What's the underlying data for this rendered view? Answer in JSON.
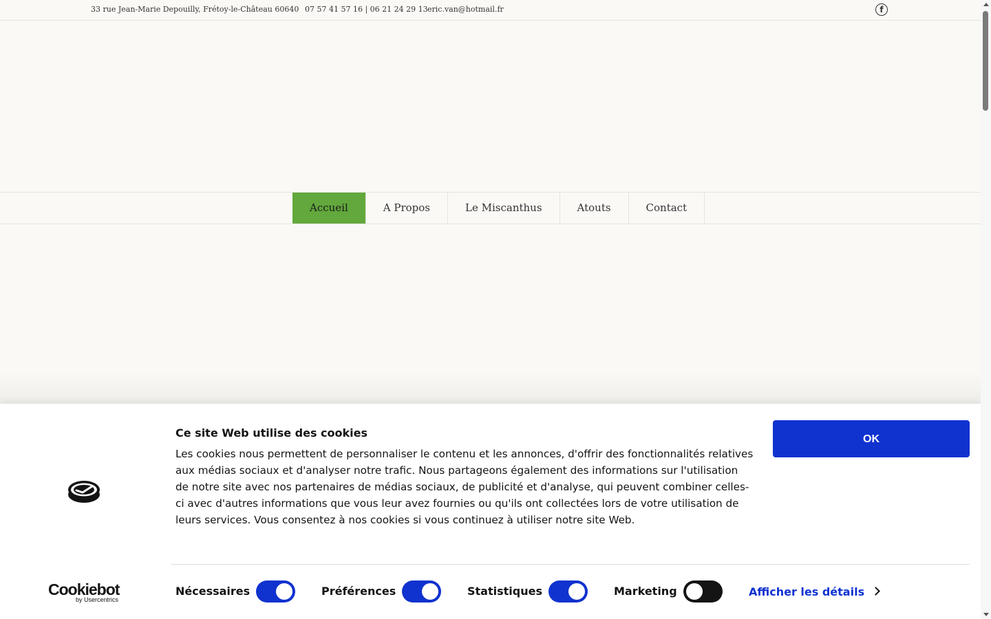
{
  "topbar": {
    "address": "33 rue Jean-Marie Depouilly, Frétoy-le-Château 60640",
    "phone": "07 57 41 57 16 | 06 21 24 29 13",
    "email": "eric.van@hotmail.fr",
    "social_icon": "facebook-icon"
  },
  "nav": {
    "items": [
      {
        "label": "Accueil",
        "active": true
      },
      {
        "label": "A Propos"
      },
      {
        "label": "Le Miscanthus"
      },
      {
        "label": "Atouts"
      },
      {
        "label": "Contact"
      }
    ]
  },
  "cookie": {
    "title": "Ce site Web utilise des cookies",
    "text": "Les cookies nous permettent de personnaliser le contenu et les annonces, d'offrir des fonctionnalités relatives aux médias sociaux et d'analyser notre trafic. Nous partageons également des informations sur l'utilisation de notre site avec nos partenaires de médias sociaux, de publicité et d'analyse, qui peuvent combiner celles-ci avec d'autres informations que vous leur avez fournies ou qu'ils ont collectées lors de votre utilisation de leurs services. Vous consentez à nos cookies si vous continuez à utiliser notre site Web.",
    "ok_label": "OK",
    "brand": "Cookiebot",
    "brand_sub": "by Usercentrics",
    "toggles": [
      {
        "label": "Nécessaires",
        "checked": true
      },
      {
        "label": "Préférences",
        "checked": true
      },
      {
        "label": "Statistiques",
        "checked": true
      },
      {
        "label": "Marketing",
        "checked": false
      }
    ],
    "details_label": "Afficher les détails"
  },
  "colors": {
    "accent_green": "#62a83c",
    "cookie_blue": "#1032cf",
    "background": "#faf9f6"
  }
}
